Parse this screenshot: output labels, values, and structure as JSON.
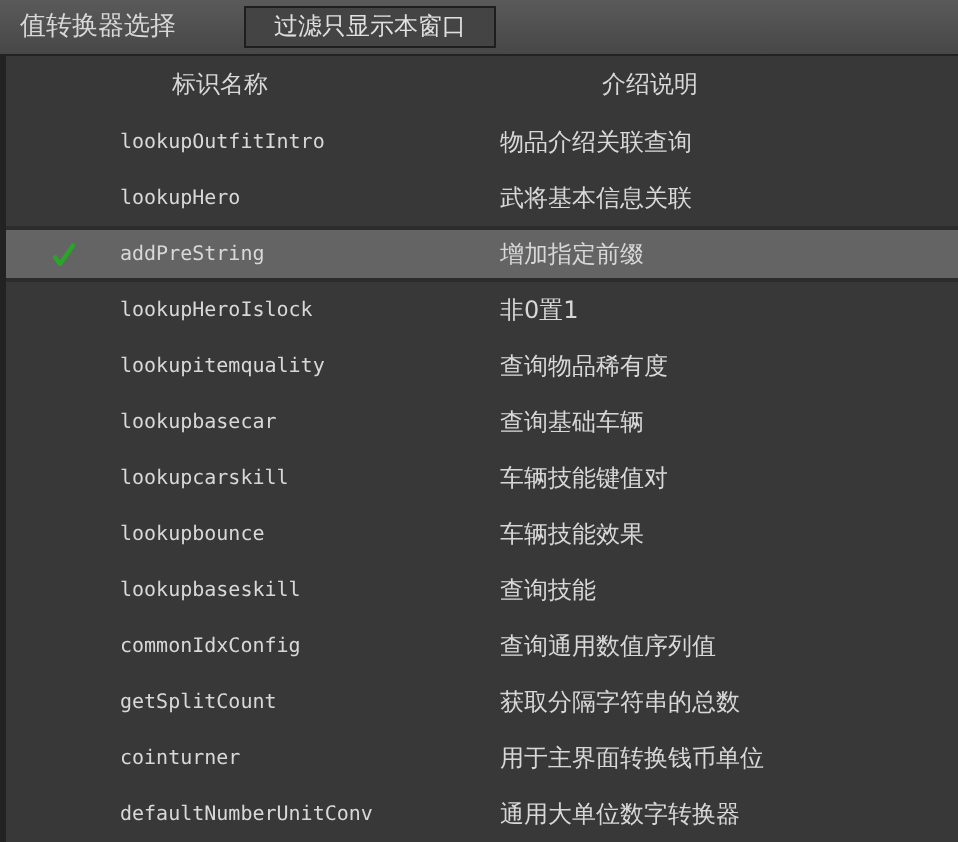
{
  "toolbar": {
    "title": "值转换器选择",
    "filter_button": "过滤只显示本窗口"
  },
  "table": {
    "columns": [
      "标识名称",
      "介绍说明"
    ],
    "rows": [
      {
        "name": "lookupOutfitIntro",
        "description": "物品介绍关联查询",
        "selected": false
      },
      {
        "name": "lookupHero",
        "description": "武将基本信息关联",
        "selected": false
      },
      {
        "name": "addPreString",
        "description": "增加指定前缀",
        "selected": true
      },
      {
        "name": "lookupHeroIslock",
        "description": "非0置1",
        "selected": false
      },
      {
        "name": "lookupitemquality",
        "description": "查询物品稀有度",
        "selected": false
      },
      {
        "name": "lookupbasecar",
        "description": "查询基础车辆",
        "selected": false
      },
      {
        "name": "lookupcarskill",
        "description": "车辆技能键值对",
        "selected": false
      },
      {
        "name": "lookupbounce",
        "description": "车辆技能效果",
        "selected": false
      },
      {
        "name": "lookupbaseskill",
        "description": "查询技能",
        "selected": false
      },
      {
        "name": "commonIdxConfig",
        "description": "查询通用数值序列值",
        "selected": false
      },
      {
        "name": "getSplitCount",
        "description": "获取分隔字符串的总数",
        "selected": false
      },
      {
        "name": "cointurner",
        "description": "用于主界面转换钱币单位",
        "selected": false
      },
      {
        "name": "defaultNumberUnitConv",
        "description": "通用大单位数字转换器",
        "selected": false
      }
    ]
  }
}
